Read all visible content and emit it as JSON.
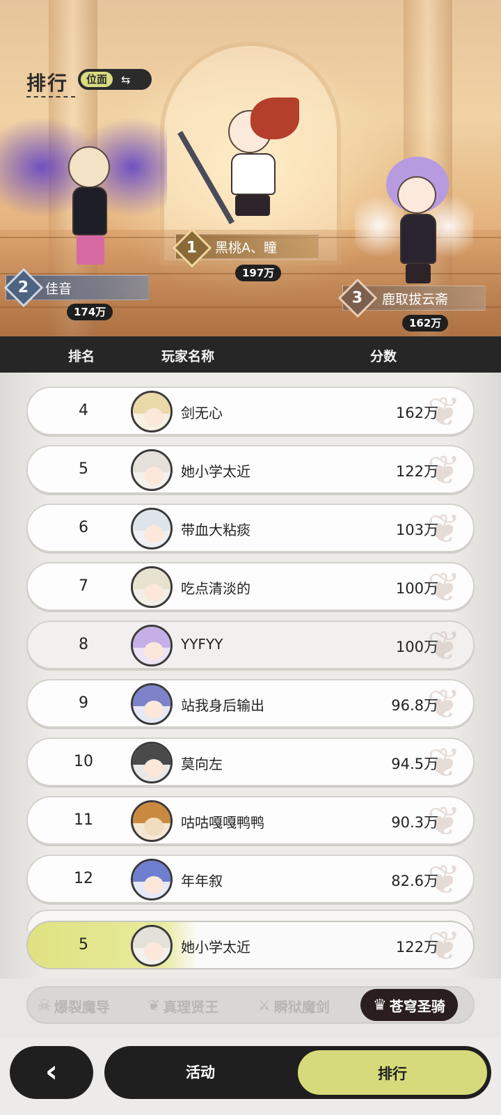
{
  "header": {
    "title": "排行",
    "plane_label": "位面",
    "swap_icon": "⇆"
  },
  "podium": [
    {
      "rank": "1",
      "name": "黑桃A、瞳",
      "score": "197万"
    },
    {
      "rank": "2",
      "name": "佳音",
      "score": "174万"
    },
    {
      "rank": "3",
      "name": "鹿取拔云斋",
      "score": "162万"
    }
  ],
  "table": {
    "col_rank": "排名",
    "col_name": "玩家名称",
    "col_score": "分数"
  },
  "rows": [
    {
      "rank": "4",
      "name": "剑无心",
      "score": "162万"
    },
    {
      "rank": "5",
      "name": "她小学太近",
      "score": "122万"
    },
    {
      "rank": "6",
      "name": "带血大粘痰",
      "score": "103万"
    },
    {
      "rank": "7",
      "name": "吃点清淡的",
      "score": "100万"
    },
    {
      "rank": "8",
      "name": "YYFYY",
      "score": "100万"
    },
    {
      "rank": "9",
      "name": "站我身后输出",
      "score": "96.8万"
    },
    {
      "rank": "10",
      "name": "莫向左",
      "score": "94.5万"
    },
    {
      "rank": "11",
      "name": "咕咕嘎嘎鸭鸭",
      "score": "90.3万"
    },
    {
      "rank": "12",
      "name": "年年叙",
      "score": "82.6万"
    }
  ],
  "self": {
    "rank": "5",
    "name": "她小学太近",
    "score": "122万"
  },
  "class_tabs": [
    {
      "label": "爆裂魔导",
      "icon": "skull-emblem-icon"
    },
    {
      "label": "真理贤王",
      "icon": "tree-emblem-icon"
    },
    {
      "label": "瞬狱魔剑",
      "icon": "sword-emblem-icon"
    },
    {
      "label": "苍穹圣骑",
      "icon": "helm-emblem-icon",
      "active": true
    }
  ],
  "bottom": {
    "back_icon": "‹",
    "tab_activity": "活动",
    "tab_rank": "排行"
  },
  "colors": {
    "accent": "#d6da7a",
    "dark": "#1f1f1f",
    "header_bg": "#262626"
  }
}
